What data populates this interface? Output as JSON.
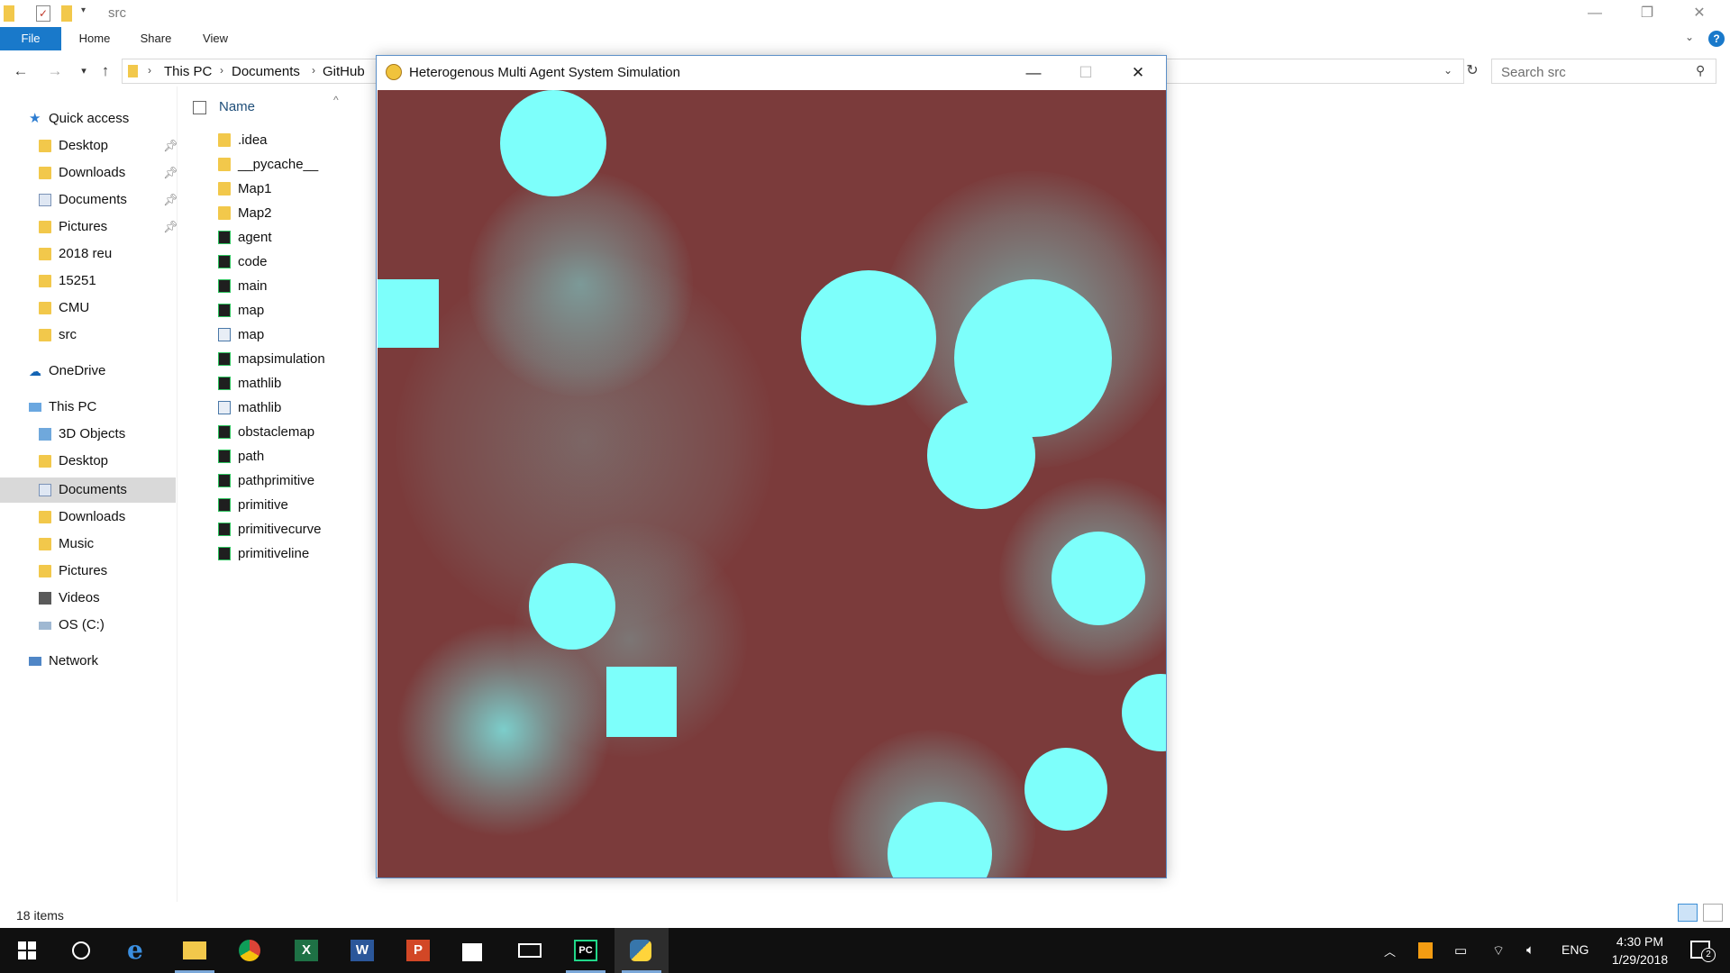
{
  "explorer": {
    "title": "src",
    "ribbon_tabs": [
      "File",
      "Home",
      "Share",
      "View"
    ],
    "breadcrumb": [
      "This PC",
      "Documents",
      "GitHub"
    ],
    "search_placeholder": "Search src",
    "quick_access": {
      "label": "Quick access",
      "items": [
        {
          "label": "Desktop",
          "icon": "desktop-folder-icon",
          "pinned": true
        },
        {
          "label": "Downloads",
          "icon": "downloads-folder-icon",
          "pinned": true
        },
        {
          "label": "Documents",
          "icon": "documents-folder-icon",
          "pinned": true
        },
        {
          "label": "Pictures",
          "icon": "pictures-folder-icon",
          "pinned": true
        },
        {
          "label": "2018 reu",
          "icon": "folder-icon",
          "pinned": false
        },
        {
          "label": "15251",
          "icon": "folder-icon",
          "pinned": false
        },
        {
          "label": "CMU",
          "icon": "folder-icon",
          "pinned": false
        },
        {
          "label": "src",
          "icon": "folder-icon",
          "pinned": false
        }
      ]
    },
    "onedrive_label": "OneDrive",
    "this_pc": {
      "label": "This PC",
      "items": [
        {
          "label": "3D Objects",
          "icon": "3d-objects-icon"
        },
        {
          "label": "Desktop",
          "icon": "desktop-folder-icon"
        },
        {
          "label": "Documents",
          "icon": "documents-folder-icon",
          "selected": true
        },
        {
          "label": "Downloads",
          "icon": "downloads-folder-icon"
        },
        {
          "label": "Music",
          "icon": "music-folder-icon"
        },
        {
          "label": "Pictures",
          "icon": "pictures-folder-icon"
        },
        {
          "label": "Videos",
          "icon": "videos-folder-icon"
        },
        {
          "label": "OS (C:)",
          "icon": "drive-icon"
        }
      ]
    },
    "network_label": "Network",
    "column_header": "Name",
    "files": [
      {
        "name": ".idea",
        "type": "folder"
      },
      {
        "name": "__pycache__",
        "type": "folder"
      },
      {
        "name": "Map1",
        "type": "folder"
      },
      {
        "name": "Map2",
        "type": "folder"
      },
      {
        "name": "agent",
        "type": "pycharm"
      },
      {
        "name": "code",
        "type": "pycharm"
      },
      {
        "name": "main",
        "type": "pycharm"
      },
      {
        "name": "map",
        "type": "pycharm"
      },
      {
        "name": "map",
        "type": "python"
      },
      {
        "name": "mapsimulation",
        "type": "pycharm"
      },
      {
        "name": "mathlib",
        "type": "pycharm"
      },
      {
        "name": "mathlib",
        "type": "python"
      },
      {
        "name": "obstaclemap",
        "type": "pycharm"
      },
      {
        "name": "path",
        "type": "pycharm"
      },
      {
        "name": "pathprimitive",
        "type": "pycharm"
      },
      {
        "name": "primitive",
        "type": "pycharm"
      },
      {
        "name": "primitivecurve",
        "type": "pycharm"
      },
      {
        "name": "primitiveline",
        "type": "pycharm"
      }
    ],
    "status_text": "18 items"
  },
  "simulation": {
    "title": "Heterogenous Multi Agent System Simulation",
    "colors": {
      "background": "#7b3b3b",
      "agent": "#7dfffb"
    }
  },
  "taskbar": {
    "apps": [
      "windows-start-icon",
      "cortana-icon",
      "edge-icon",
      "file-explorer-icon",
      "chrome-icon",
      "excel-icon",
      "word-icon",
      "powerpoint-icon",
      "store-icon",
      "mail-icon",
      "pycharm-icon",
      "python-icon"
    ],
    "language": "ENG",
    "time": "4:30 PM",
    "date": "1/29/2018",
    "notification_count": "2"
  }
}
